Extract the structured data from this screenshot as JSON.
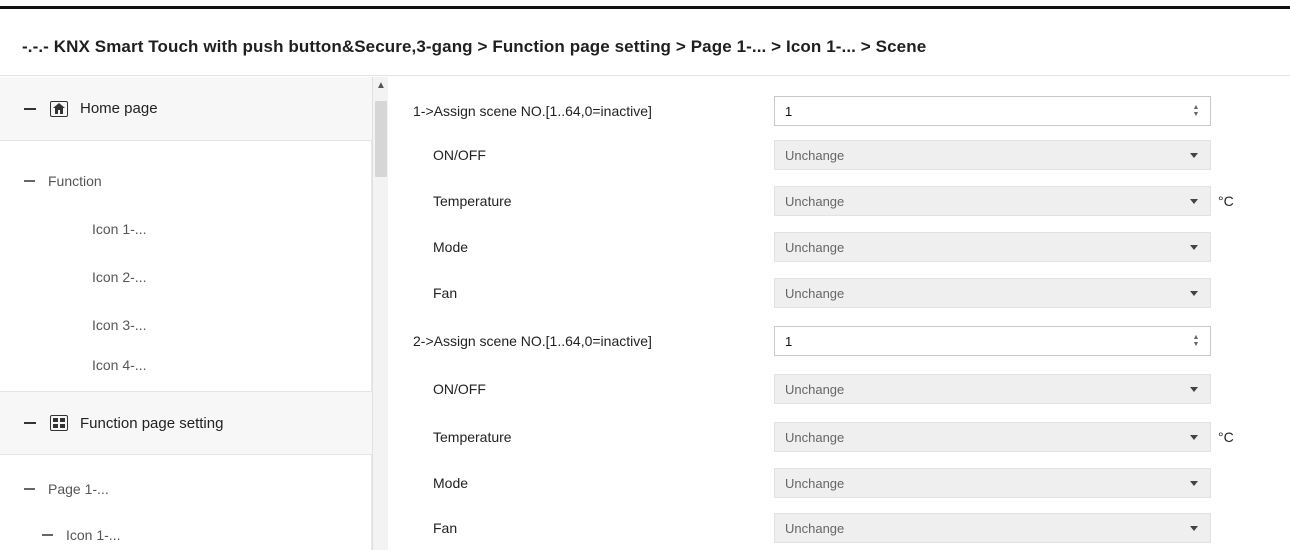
{
  "breadcrumb": "-.-.- KNX Smart Touch with push button&Secure,3-gang > Function page setting > Page 1-... > Icon 1-... > Scene",
  "sidebar": {
    "sections": [
      {
        "label": "Home page",
        "icon": "home-icon"
      },
      {
        "label": "Function page setting",
        "icon": "grid-icon"
      }
    ],
    "items": [
      {
        "label": "Function"
      },
      {
        "label": "Icon 1-..."
      },
      {
        "label": "Icon 2-..."
      },
      {
        "label": "Icon 3-..."
      },
      {
        "label": "Icon 4-..."
      },
      {
        "label": "Page 1-..."
      },
      {
        "label": "Icon 1-..."
      }
    ]
  },
  "params": [
    {
      "label": "1->Assign scene NO.[1..64,0=inactive]",
      "value": "1",
      "type": "spin"
    },
    {
      "label": "ON/OFF",
      "value": "Unchange",
      "type": "select"
    },
    {
      "label": "Temperature",
      "value": "Unchange",
      "type": "select",
      "unit": "°C"
    },
    {
      "label": "Mode",
      "value": "Unchange",
      "type": "select"
    },
    {
      "label": "Fan",
      "value": "Unchange",
      "type": "select"
    },
    {
      "label": "2->Assign scene NO.[1..64,0=inactive]",
      "value": "1",
      "type": "spin"
    },
    {
      "label": "ON/OFF",
      "value": "Unchange",
      "type": "select"
    },
    {
      "label": "Temperature",
      "value": "Unchange",
      "type": "select",
      "unit": "°C"
    },
    {
      "label": "Mode",
      "value": "Unchange",
      "type": "select"
    },
    {
      "label": "Fan",
      "value": "Unchange",
      "type": "select"
    }
  ],
  "colors": {
    "selected_bg": "#f7f7f7",
    "select_bg": "#efefef",
    "input_border": "#c9c9c9"
  }
}
